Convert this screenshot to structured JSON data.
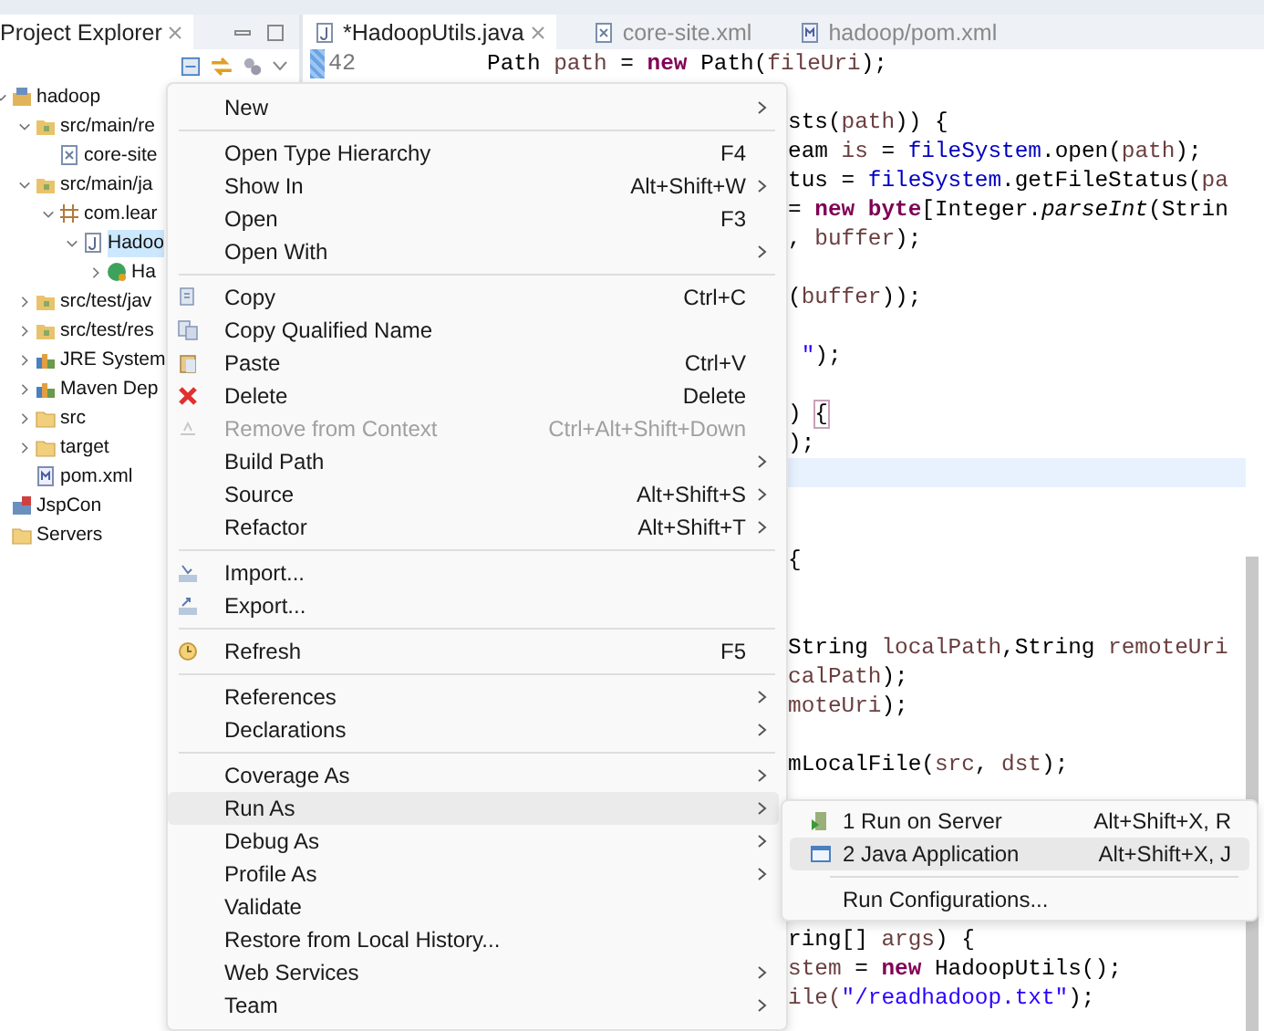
{
  "explorer": {
    "tab": {
      "label": "Project Explorer",
      "selected": true
    },
    "tree": [
      {
        "label": "hadoop",
        "kind": "project",
        "expanded": true,
        "selected": false,
        "children": [
          {
            "label": "src/main/re",
            "kind": "srcfolder",
            "expanded": true,
            "selected": false,
            "children": [
              {
                "label": "core-site",
                "kind": "xml",
                "selected": false
              }
            ]
          },
          {
            "label": "src/main/ja",
            "kind": "srcfolder",
            "expanded": true,
            "selected": false,
            "children": [
              {
                "label": "com.lear",
                "kind": "package",
                "expanded": true,
                "selected": false,
                "children": [
                  {
                    "label": "Hadoo",
                    "kind": "javafile",
                    "expanded": true,
                    "selected": true,
                    "children": [
                      {
                        "label": "Ha",
                        "kind": "class",
                        "expanded": false,
                        "selected": false
                      }
                    ]
                  }
                ]
              }
            ]
          },
          {
            "label": "src/test/jav",
            "kind": "srcfolder",
            "expanded": false,
            "selected": false
          },
          {
            "label": "src/test/res",
            "kind": "srcfolder",
            "expanded": false,
            "selected": false
          },
          {
            "label": "JRE System",
            "kind": "library",
            "expanded": false,
            "selected": false
          },
          {
            "label": "Maven Dep",
            "kind": "library",
            "expanded": false,
            "selected": false
          },
          {
            "label": "src",
            "kind": "folder",
            "expanded": false,
            "selected": false
          },
          {
            "label": "target",
            "kind": "folder",
            "expanded": false,
            "selected": false
          },
          {
            "label": "pom.xml",
            "kind": "maven",
            "selected": false
          }
        ]
      },
      {
        "label": "JspCon",
        "kind": "webproject",
        "selected": false
      },
      {
        "label": "Servers",
        "kind": "folder",
        "selected": false
      }
    ]
  },
  "editor": {
    "tabs": [
      {
        "label": "*HadoopUtils.java",
        "kind": "javafile",
        "selected": true
      },
      {
        "label": "core-site.xml",
        "kind": "xml",
        "selected": false
      },
      {
        "label": "hadoop/pom.xml",
        "kind": "maven",
        "selected": false
      }
    ],
    "lines": [
      {
        "kind": "full",
        "number": "42",
        "tokens": [
          {
            "text": "Path ",
            "kind": "plain"
          },
          {
            "text": "path",
            "kind": "var"
          },
          {
            "text": " = ",
            "kind": "plain"
          },
          {
            "text": "new",
            "kind": "kw"
          },
          {
            "text": " Path(",
            "kind": "plain"
          },
          {
            "text": "fileUri",
            "kind": "var"
          },
          {
            "text": ");",
            "kind": "plain"
          }
        ]
      },
      {
        "kind": "blank"
      },
      {
        "kind": "partial",
        "tokens": [
          {
            "text": "sts(",
            "kind": "plain"
          },
          {
            "text": "path",
            "kind": "var"
          },
          {
            "text": ")) {",
            "kind": "plain"
          }
        ]
      },
      {
        "kind": "partial",
        "tokens": [
          {
            "text": "eam ",
            "kind": "plain"
          },
          {
            "text": "is",
            "kind": "var"
          },
          {
            "text": " = ",
            "kind": "plain"
          },
          {
            "text": "fileSystem",
            "kind": "field"
          },
          {
            "text": ".open(",
            "kind": "plain"
          },
          {
            "text": "path",
            "kind": "var"
          },
          {
            "text": ");",
            "kind": "plain"
          }
        ]
      },
      {
        "kind": "partial",
        "tokens": [
          {
            "text": "tus = ",
            "kind": "plain"
          },
          {
            "text": "fileSystem",
            "kind": "field"
          },
          {
            "text": ".getFileStatus(",
            "kind": "plain"
          },
          {
            "text": "pa",
            "kind": "var"
          }
        ]
      },
      {
        "kind": "partial",
        "tokens": [
          {
            "text": "= ",
            "kind": "plain"
          },
          {
            "text": "new byte",
            "kind": "kw"
          },
          {
            "text": "[Integer.",
            "kind": "plain"
          },
          {
            "text": "parseInt",
            "kind": "italic"
          },
          {
            "text": "(Strin",
            "kind": "plain"
          }
        ]
      },
      {
        "kind": "partial",
        "tokens": [
          {
            "text": ", ",
            "kind": "plain"
          },
          {
            "text": "buffer",
            "kind": "var"
          },
          {
            "text": ");",
            "kind": "plain"
          }
        ]
      },
      {
        "kind": "blank"
      },
      {
        "kind": "partial",
        "tokens": [
          {
            "text": "(",
            "kind": "plain"
          },
          {
            "text": "buffer",
            "kind": "var"
          },
          {
            "text": "));",
            "kind": "plain"
          }
        ]
      },
      {
        "kind": "blank"
      },
      {
        "kind": "partial",
        "tokens": [
          {
            "text": " \"",
            "kind": "str"
          },
          {
            "text": ");",
            "kind": "plain"
          }
        ]
      },
      {
        "kind": "blank"
      },
      {
        "kind": "partial",
        "tokens": [
          {
            "text": ") ",
            "kind": "plain"
          },
          {
            "text": "{",
            "kind": "match"
          }
        ]
      },
      {
        "kind": "partial",
        "tokens": [
          {
            "text": ");",
            "kind": "plain"
          }
        ]
      },
      {
        "kind": "blank",
        "current": true
      },
      {
        "kind": "blank"
      },
      {
        "kind": "blank"
      },
      {
        "kind": "partial",
        "tokens": [
          {
            "text": "{",
            "kind": "plain"
          }
        ]
      },
      {
        "kind": "blank"
      },
      {
        "kind": "blank"
      },
      {
        "kind": "partial",
        "tokens": [
          {
            "text": "String ",
            "kind": "plain"
          },
          {
            "text": "localPath",
            "kind": "var"
          },
          {
            "text": ",String ",
            "kind": "plain"
          },
          {
            "text": "remoteUri",
            "kind": "var"
          }
        ]
      },
      {
        "kind": "partial",
        "tokens": [
          {
            "text": "calPath",
            "kind": "var"
          },
          {
            "text": ");",
            "kind": "plain"
          }
        ]
      },
      {
        "kind": "partial",
        "tokens": [
          {
            "text": "moteUri",
            "kind": "var"
          },
          {
            "text": ");",
            "kind": "plain"
          }
        ]
      },
      {
        "kind": "blank"
      },
      {
        "kind": "partial",
        "tokens": [
          {
            "text": "mLocalFile(",
            "kind": "plain"
          },
          {
            "text": "src",
            "kind": "var"
          },
          {
            "text": ", ",
            "kind": "plain"
          },
          {
            "text": "dst",
            "kind": "var"
          },
          {
            "text": ");",
            "kind": "plain"
          }
        ]
      },
      {
        "kind": "blank"
      },
      {
        "kind": "blank"
      },
      {
        "kind": "blank"
      },
      {
        "kind": "blank"
      },
      {
        "kind": "blank"
      },
      {
        "kind": "partial",
        "tokens": [
          {
            "text": "ring[] ",
            "kind": "plain"
          },
          {
            "text": "args",
            "kind": "var"
          },
          {
            "text": ") {",
            "kind": "plain"
          }
        ]
      },
      {
        "kind": "partial",
        "tokens": [
          {
            "text": "stem",
            "kind": "var"
          },
          {
            "text": " = ",
            "kind": "plain"
          },
          {
            "text": "new",
            "kind": "kw"
          },
          {
            "text": " HadoopUtils();",
            "kind": "plain"
          }
        ]
      },
      {
        "kind": "partial",
        "tokens": [
          {
            "text": "ile(",
            "kind": "var"
          },
          {
            "text": "\"/readhadoop.txt\"",
            "kind": "str"
          },
          {
            "text": ");",
            "kind": "plain"
          }
        ]
      }
    ]
  },
  "context_menu": [
    {
      "kind": "plain",
      "label": "New",
      "submenu": true
    },
    {
      "kind": "separator"
    },
    {
      "kind": "plain",
      "label": "Open Type Hierarchy",
      "shortcut": "F4"
    },
    {
      "kind": "plain",
      "label": "Show In",
      "shortcut": "Alt+Shift+W",
      "submenu": true
    },
    {
      "kind": "plain",
      "label": "Open",
      "shortcut": "F3"
    },
    {
      "kind": "plain",
      "label": "Open With",
      "submenu": true
    },
    {
      "kind": "separator"
    },
    {
      "kind": "copy",
      "label": "Copy",
      "shortcut": "Ctrl+C"
    },
    {
      "kind": "copy-name",
      "label": "Copy Qualified Name"
    },
    {
      "kind": "paste",
      "label": "Paste",
      "shortcut": "Ctrl+V"
    },
    {
      "kind": "delete",
      "label": "Delete",
      "shortcut": "Delete"
    },
    {
      "kind": "remove",
      "label": "Remove from Context",
      "shortcut": "Ctrl+Alt+Shift+Down",
      "disabled": true
    },
    {
      "kind": "plain",
      "label": "Build Path",
      "submenu": true
    },
    {
      "kind": "plain",
      "label": "Source",
      "shortcut": "Alt+Shift+S",
      "submenu": true
    },
    {
      "kind": "plain",
      "label": "Refactor",
      "shortcut": "Alt+Shift+T",
      "submenu": true
    },
    {
      "kind": "separator"
    },
    {
      "kind": "import",
      "label": "Import..."
    },
    {
      "kind": "export",
      "label": "Export..."
    },
    {
      "kind": "separator"
    },
    {
      "kind": "refresh",
      "label": "Refresh",
      "shortcut": "F5"
    },
    {
      "kind": "separator"
    },
    {
      "kind": "plain",
      "label": "References",
      "submenu": true
    },
    {
      "kind": "plain",
      "label": "Declarations",
      "submenu": true
    },
    {
      "kind": "separator"
    },
    {
      "kind": "plain",
      "label": "Coverage As",
      "submenu": true
    },
    {
      "kind": "plain",
      "label": "Run As",
      "submenu": true,
      "selected": true
    },
    {
      "kind": "plain",
      "label": "Debug As",
      "submenu": true
    },
    {
      "kind": "plain",
      "label": "Profile As",
      "submenu": true
    },
    {
      "kind": "plain",
      "label": "Validate"
    },
    {
      "kind": "plain",
      "label": "Restore from Local History..."
    },
    {
      "kind": "plain",
      "label": "Web Services",
      "submenu": true
    },
    {
      "kind": "plain",
      "label": "Team",
      "submenu": true
    }
  ],
  "run_as_menu": [
    {
      "kind": "server",
      "label": "1 Run on Server",
      "shortcut": "Alt+Shift+X, R",
      "selected": false
    },
    {
      "kind": "app",
      "label": "2 Java Application",
      "shortcut": "Alt+Shift+X, J",
      "selected": true
    },
    {
      "kind": "separator"
    },
    {
      "kind": "plain",
      "label": "Run Configurations...",
      "selected": false
    }
  ]
}
